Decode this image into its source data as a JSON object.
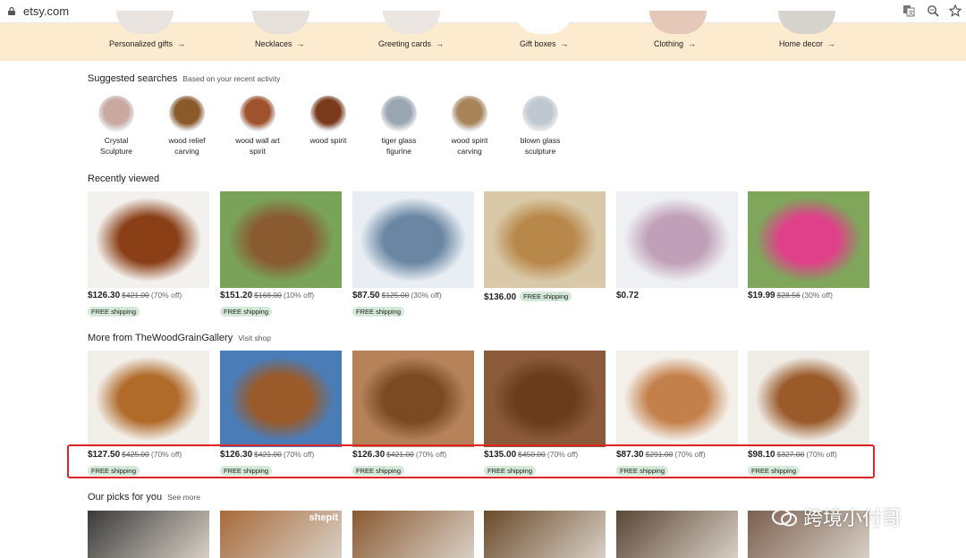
{
  "browser": {
    "url": "etsy.com",
    "icons": [
      "lock-icon",
      "translate-icon",
      "zoom-icon",
      "star-icon"
    ]
  },
  "categories": [
    {
      "label": "Personalized gifts"
    },
    {
      "label": "Necklaces"
    },
    {
      "label": "Greeting cards"
    },
    {
      "label": "Gift boxes"
    },
    {
      "label": "Clothing"
    },
    {
      "label": "Home decor"
    }
  ],
  "suggested": {
    "title": "Suggested searches",
    "subtitle": "Based on your recent activity",
    "items": [
      {
        "label": "Crystal Sculpture",
        "color": "#c9a8a0"
      },
      {
        "label": "wood relief carving",
        "color": "#8b5a2b"
      },
      {
        "label": "wood wall art spirit",
        "color": "#a0522d"
      },
      {
        "label": "wood spirit",
        "color": "#7a3b1c"
      },
      {
        "label": "tiger glass figurine",
        "color": "#9aa6b2"
      },
      {
        "label": "wood spirit carving",
        "color": "#a9845a"
      },
      {
        "label": "blown glass sculpture",
        "color": "#bfc8d0"
      }
    ]
  },
  "recently_viewed": {
    "title": "Recently viewed",
    "items": [
      {
        "price": "$126.30",
        "orig": "$421.00",
        "off": "(70% off)",
        "badge": "FREE shipping",
        "bg": "#f3f1ee",
        "fg": "#8a3f16"
      },
      {
        "price": "$151.20",
        "orig": "$168.00",
        "off": "(10% off)",
        "badge": "FREE shipping",
        "bg": "#7aa35a",
        "fg": "#8a5a30"
      },
      {
        "price": "$87.50",
        "orig": "$125.00",
        "off": "(30% off)",
        "badge": "FREE shipping",
        "bg": "#e8eef3",
        "fg": "#6a86a3"
      },
      {
        "price": "$136.00",
        "orig": "",
        "off": "",
        "badge": "FREE shipping",
        "bg": "#d9c9a8",
        "fg": "#b8874a"
      },
      {
        "price": "$0.72",
        "orig": "",
        "off": "",
        "badge": "",
        "bg": "#eef0f3",
        "fg": "#c0a0b8"
      },
      {
        "price": "$19.99",
        "orig": "$28.56",
        "off": "(30% off)",
        "badge": "",
        "bg": "#7fa65b",
        "fg": "#e0408a"
      }
    ]
  },
  "more_from": {
    "title": "More from TheWoodGrainGallery",
    "link": "Visit shop",
    "items": [
      {
        "price": "$127.50",
        "orig": "$425.00",
        "off": "(70% off)",
        "badge": "FREE shipping",
        "bg": "#f2efe9",
        "fg": "#b06a2a"
      },
      {
        "price": "$126.30",
        "orig": "$421.00",
        "off": "(70% off)",
        "badge": "FREE shipping",
        "bg": "#4a7db8",
        "fg": "#9a5a2a"
      },
      {
        "price": "$126.30",
        "orig": "$421.00",
        "off": "(70% off)",
        "badge": "FREE shipping",
        "bg": "#b5825a",
        "fg": "#7a4a22"
      },
      {
        "price": "$135.00",
        "orig": "$450.00",
        "off": "(70% off)",
        "badge": "FREE shipping",
        "bg": "#8a5a3a",
        "fg": "#6a3c1c"
      },
      {
        "price": "$87.30",
        "orig": "$291.00",
        "off": "(70% off)",
        "badge": "FREE shipping",
        "bg": "#f3efe9",
        "fg": "#c4804a"
      },
      {
        "price": "$98.10",
        "orig": "$327.00",
        "off": "(70% off)",
        "badge": "FREE shipping",
        "bg": "#efece6",
        "fg": "#9a5a2a"
      }
    ]
  },
  "picks": {
    "title": "Our picks for you",
    "link": "See more",
    "items": [
      {
        "bg": "#3a3a3a",
        "overlay": ""
      },
      {
        "bg": "#a86a3a",
        "overlay": "shepit"
      },
      {
        "bg": "#8a5a32",
        "overlay": ""
      },
      {
        "bg": "#6a4a2a",
        "overlay": ""
      },
      {
        "bg": "#5a4636",
        "overlay": ""
      },
      {
        "bg": "#7a6050",
        "overlay": ""
      }
    ]
  },
  "watermark": {
    "text": "跨境小付哥"
  }
}
